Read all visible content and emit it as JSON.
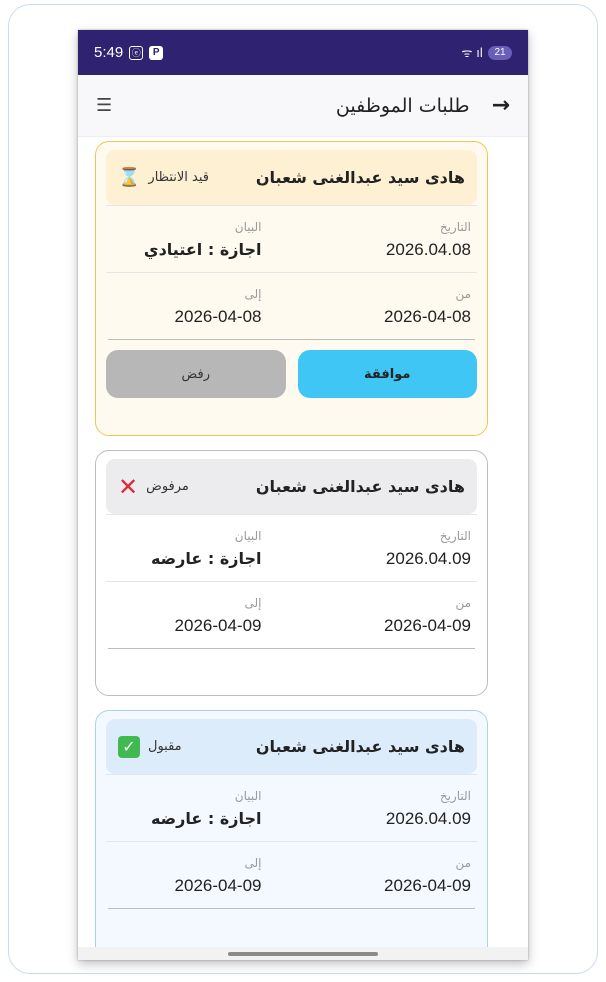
{
  "status_bar": {
    "time": "5:49",
    "icon_a": "ⓔ",
    "icon_p": "P",
    "signal": "ᯤ ıl",
    "battery": "21"
  },
  "app_bar": {
    "title": "طلبات الموظفين",
    "back_glyph": "→",
    "menu_glyph": "☰"
  },
  "labels": {
    "date": "التاريخ",
    "statement": "البيان",
    "from": "من",
    "to": "إلى"
  },
  "requests": [
    {
      "employee": "هادى سيد عبدالغنى شعبان",
      "status": "قيد الانتظار",
      "status_icon": "hourglass-icon",
      "date": "2026.04.08",
      "statement": "اجازة : اعتيادي",
      "from": "2026-04-08",
      "to": "2026-04-08",
      "approve_label": "موافقة",
      "reject_label": "رفض"
    },
    {
      "employee": "هادى سيد عبدالغنى شعبان",
      "status": "مرفوض",
      "status_icon": "x-mark-icon",
      "date": "2026.04.09",
      "statement": "اجازة : عارضه",
      "from": "2026-04-09",
      "to": "2026-04-09"
    },
    {
      "employee": "هادى سيد عبدالغنى شعبان",
      "status": "مقبول",
      "status_icon": "check-mark-icon",
      "date": "2026.04.09",
      "statement": "اجازة : عارضه",
      "from": "2026-04-09",
      "to": "2026-04-09"
    }
  ],
  "colors": {
    "status_bar": "#2f2270",
    "approve_button": "#3fc6f4",
    "reject_button": "#b7b7b7",
    "pending_border": "#f0c454",
    "accepted_border": "#a9d2f2",
    "rejected_icon": "#e0283a",
    "accepted_icon": "#3fb950"
  }
}
